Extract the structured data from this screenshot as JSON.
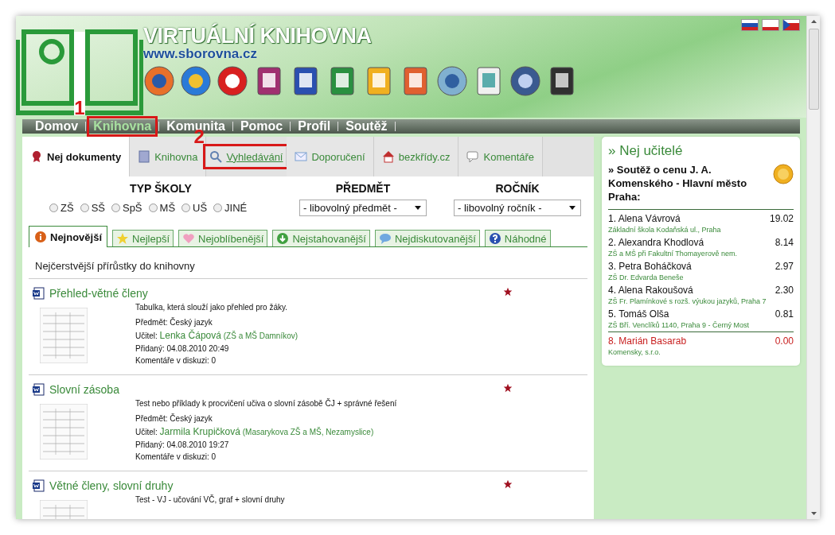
{
  "header": {
    "title": "VIRTUÁLNÍ KNIHOVNA",
    "url": "www.sborovna.cz"
  },
  "nav": [
    {
      "label": "Domov",
      "selected": false
    },
    {
      "label": "Knihovna",
      "selected": true,
      "callout": "1"
    },
    {
      "label": "Komunita",
      "selected": false
    },
    {
      "label": "Pomoc",
      "selected": false
    },
    {
      "label": "Profil",
      "selected": false
    },
    {
      "label": "Soutěž",
      "selected": false
    }
  ],
  "tabs": [
    {
      "label": "Nej dokumenty",
      "selected": true
    },
    {
      "label": "Knihovna",
      "selected": false
    },
    {
      "label": "Vyhledávání",
      "selected": false,
      "callout": "2"
    },
    {
      "label": "Doporučení",
      "selected": false
    },
    {
      "label": "bezkřídy.cz",
      "selected": false
    },
    {
      "label": "Komentáře",
      "selected": false
    }
  ],
  "filters": {
    "school_type": {
      "label": "TYP ŠKOLY",
      "options": [
        {
          "label": "ZŠ",
          "selected": false
        },
        {
          "label": "SŠ",
          "selected": false
        },
        {
          "label": "SpŠ",
          "selected": false
        },
        {
          "label": "MŠ",
          "selected": false
        },
        {
          "label": "UŠ",
          "selected": false
        },
        {
          "label": "JINÉ",
          "selected": false
        }
      ]
    },
    "subject": {
      "label": "PŘEDMĚT",
      "value": "- libovolný předmět -"
    },
    "grade": {
      "label": "ROČNÍK",
      "value": "- libovolný ročník -"
    }
  },
  "subtabs": [
    {
      "label": "Nejnovější",
      "selected": true
    },
    {
      "label": "Nejlepší",
      "selected": false
    },
    {
      "label": "Nejoblíbenější",
      "selected": false
    },
    {
      "label": "Nejstahovanější",
      "selected": false
    },
    {
      "label": "Nejdiskutovanější",
      "selected": false
    },
    {
      "label": "Náhodné",
      "selected": false
    }
  ],
  "section_title": "Nejčerstvější přírůstky do knihovny",
  "documents": [
    {
      "title": "Přehled-větné členy",
      "description": "Tabulka, která slouží jako přehled pro žáky.",
      "subject": "Předmět: Český jazyk",
      "teacher_label": "Učitel:",
      "teacher": "Lenka Čápová",
      "school": "(ZŠ a MŠ Damníkov)",
      "added": "Přidaný: 04.08.2010 20:49",
      "comments": "Komentáře v diskuzi: 0"
    },
    {
      "title": "Slovní zásoba",
      "description": "Test nebo příklady k procvičení učiva o slovní zásobě ČJ + správné řešení",
      "subject": "Předmět: Český jazyk",
      "teacher_label": "Učitel:",
      "teacher": "Jarmila Krupičková",
      "school": "(Masarykova ZŠ a MŠ, Nezamyslice)",
      "added": "Přidaný: 04.08.2010 19:27",
      "comments": "Komentáře v diskuzi: 0"
    },
    {
      "title": "Větné členy, slovní druhy",
      "description": "Test - VJ - učování VČ, graf + slovní druhy"
    }
  ],
  "sidebar": {
    "title": "» Nej učitelé",
    "contest": "» Soutěž o cenu J. A. Komenského - Hlavní město Praha:",
    "ranking": [
      {
        "name": "1. Alena Vávrová",
        "score": "19.02",
        "school": "Základní škola Kodaňská ul., Praha",
        "current": false
      },
      {
        "name": "2. Alexandra Khodlová",
        "score": "8.14",
        "school": "ZŠ a MŠ při Fakultní Thomayerově nem.",
        "current": false
      },
      {
        "name": "3. Petra Boháčková",
        "score": "2.97",
        "school": "ZŠ Dr. Edvarda Beneše",
        "current": false
      },
      {
        "name": "4. Alena Rakoušová",
        "score": "2.30",
        "school": "ZŠ Fr. Plamínkové s rozš. výukou jazyků, Praha 7",
        "current": false
      },
      {
        "name": "5. Tomáš Olša",
        "score": "0.81",
        "school": "ZŠ Bří. Venclíků 1140, Praha 9 - Černý Most",
        "current": false
      },
      {
        "name": "8. Marián Basarab",
        "score": "0.00",
        "school": "Komensky, s.r.o.",
        "current": true
      }
    ]
  }
}
